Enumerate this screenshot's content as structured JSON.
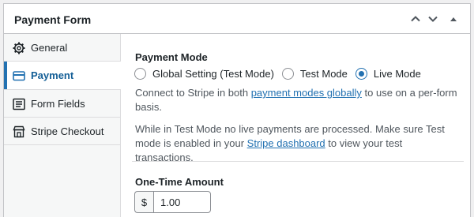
{
  "panel": {
    "title": "Payment Form",
    "buttons": [
      "move-up",
      "move-down",
      "collapse"
    ]
  },
  "sidebar": {
    "items": [
      {
        "label": "General",
        "icon": "gear-icon",
        "active": false
      },
      {
        "label": "Payment",
        "icon": "credit-card-icon",
        "active": true
      },
      {
        "label": "Form Fields",
        "icon": "list-icon",
        "active": false
      },
      {
        "label": "Stripe Checkout",
        "icon": "storefront-icon",
        "active": false
      }
    ]
  },
  "payment_mode": {
    "label": "Payment Mode",
    "options": [
      {
        "label": "Global Setting (Test Mode)",
        "selected": false
      },
      {
        "label": "Test Mode",
        "selected": false
      },
      {
        "label": "Live Mode",
        "selected": true
      }
    ],
    "desc1_pre": "Connect to Stripe in both ",
    "desc1_link": "payment modes globally",
    "desc1_post": " to use on a per-form basis.",
    "desc2_pre": "While in Test Mode no live payments are processed. Make sure Test mode is enabled in your ",
    "desc2_link": "Stripe dashboard",
    "desc2_post": " to view your test transactions."
  },
  "amount": {
    "label": "One-Time Amount",
    "currency_symbol": "$",
    "value": "1.00"
  },
  "colors": {
    "accent": "#2271b1",
    "active_text": "#135e96",
    "border": "#c3c4c7"
  }
}
